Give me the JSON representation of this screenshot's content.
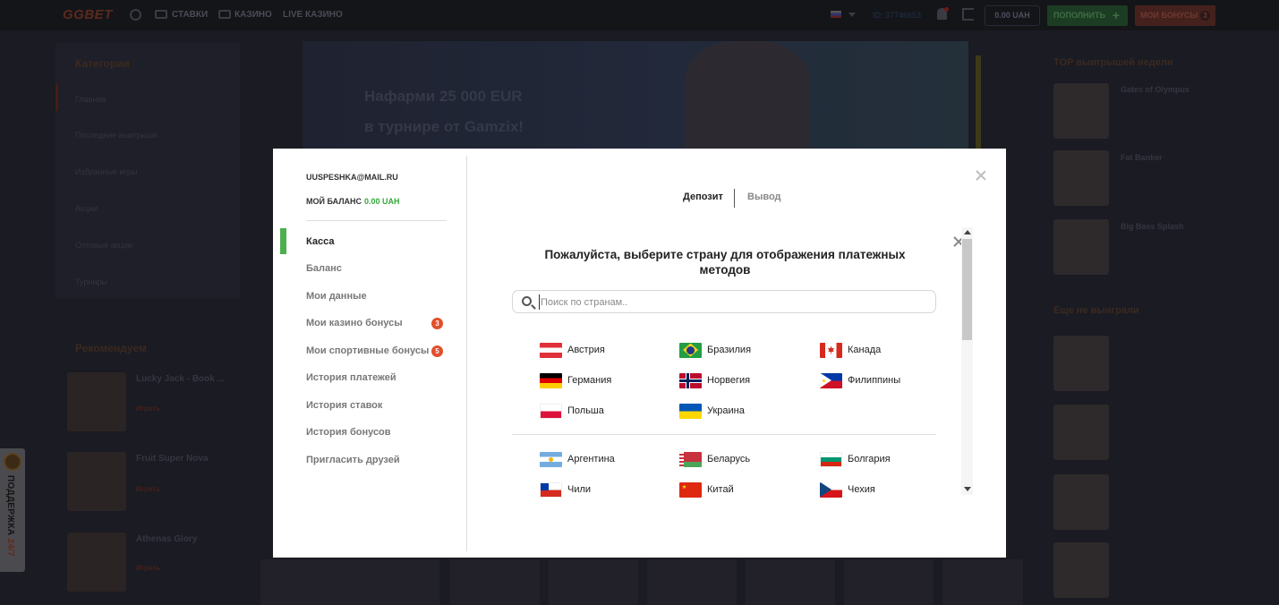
{
  "site": {
    "logo": "GGBET",
    "nav": [
      "СТАВКИ",
      "КАЗИНО",
      "LIVE КАЗИНО"
    ],
    "user_id": "ID: 37746653",
    "balance": "0.00 UAH",
    "deposit_button": "ПОПОЛНИТЬ",
    "bonuses_button": "МОИ БОНУСЫ",
    "bonuses_count": "3",
    "sidebar_heading": "Категории",
    "sidebar_items": [
      "Главная",
      "Последние выигрыши",
      "Избранные игры",
      "Акции",
      "Оптовые акции",
      "Турниры"
    ],
    "recommended_heading": "Рекомендуем",
    "banner_line1": "Нафарми 25 000 EUR",
    "banner_line2": "в турнире от Gamzix!",
    "right_heading": "TOP выигрышей недели",
    "right_heading2": "Еще не выиграли",
    "support": "ПОДДЕРЖКА",
    "support_247": "24/7"
  },
  "modal": {
    "email": "UUSPESHKA@MAIL.RU",
    "balance_label": "МОЙ БАЛАНС",
    "balance_value": "0.00 UAH",
    "menu": [
      {
        "label": "Касса",
        "active": true
      },
      {
        "label": "Баланс"
      },
      {
        "label": "Мои данные"
      },
      {
        "label": "Мои казино бонусы",
        "badge": "3"
      },
      {
        "label": "Мои спортивные бонусы",
        "badge": "5"
      },
      {
        "label": "История платежей"
      },
      {
        "label": "История ставок"
      },
      {
        "label": "История бонусов"
      },
      {
        "label": "Пригласить друзей"
      }
    ],
    "tabs": [
      {
        "label": "Депозит",
        "active": true
      },
      {
        "label": "Вывод"
      }
    ],
    "prompt": "Пожалуйста, выберите страну для отображения платежных методов",
    "search_placeholder": "Поиск по странам..",
    "countries_primary": [
      "Австрия",
      "Бразилия",
      "Канада",
      "Германия",
      "Норвегия",
      "Филиппины",
      "Польша",
      "Украина"
    ],
    "countries_other": [
      "Аргентина",
      "Беларусь",
      "Болгария",
      "Чили",
      "Китай",
      "Чехия"
    ]
  },
  "colors": {
    "accent_green": "#4cb04f",
    "badge_red": "#e24e2c",
    "balance_green": "#35a83a"
  }
}
